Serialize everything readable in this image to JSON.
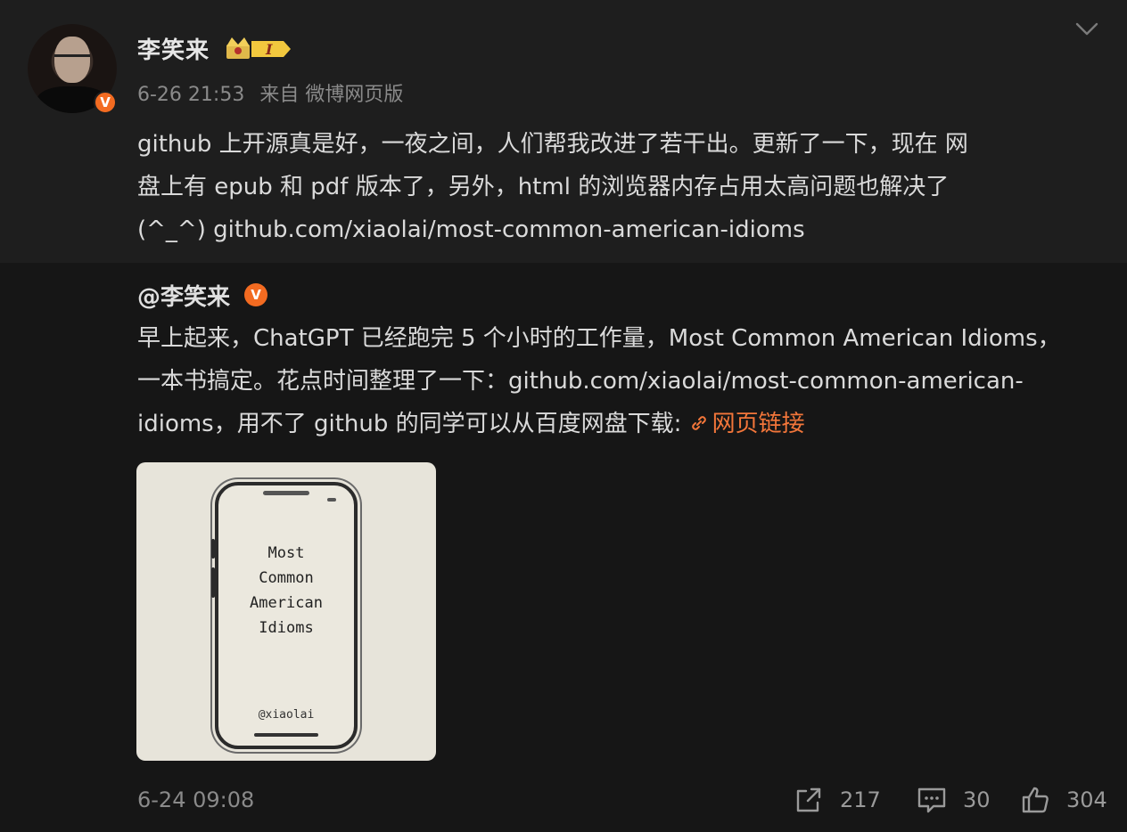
{
  "author": {
    "name": "李笑来",
    "verified_badge": "V",
    "member_level_badge": "I",
    "avatar_icon": "portrait-avatar"
  },
  "post": {
    "date": "6-26 21:53",
    "source": "来自 微博网页版",
    "text_line1": "github 上开源真是好，一夜之间，人们帮我改进了若干出。更新了一下，现在 网",
    "text_line2": "盘上有 epub 和 pdf 版本了，另外，html 的浏览器内存占用太高问题也解决了",
    "text_line3": "(^_^) github.com/xiaolai/most-common-american-idioms"
  },
  "repost": {
    "mention": "@李笑来",
    "verified_badge": "V",
    "text_line1": "早上起来，ChatGPT 已经跑完 5 个小时的工作量，Most Common American Idioms，",
    "text_line2": "一本书搞定。花点时间整理了一下：github.com/xiaolai/most-common-american-",
    "text_line3": "idioms，用不了 github 的同学可以从百度网盘下载: ",
    "link_label": "网页链接",
    "image": {
      "title": "Most\nCommon\nAmerican\nIdioms",
      "handle": "@xiaolai"
    },
    "date": "6-24 09:08",
    "reposts": "217",
    "comments": "30",
    "likes": "304"
  },
  "colors": {
    "accent": "#f36b21",
    "link": "#f3763a",
    "background": "#161616",
    "top_background": "#1e1e1e"
  },
  "icons": [
    "chevron-down-icon",
    "share-icon",
    "comment-icon",
    "like-icon",
    "link-icon",
    "crown-icon"
  ]
}
